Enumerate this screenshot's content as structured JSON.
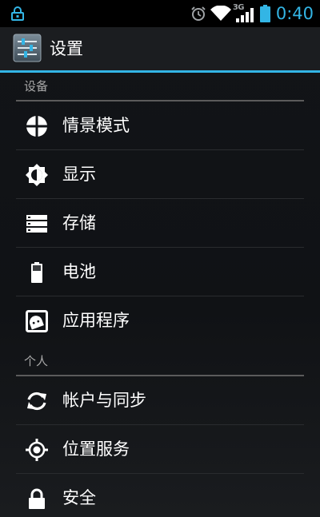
{
  "status_bar": {
    "network_type": "3G",
    "clock": "0:40",
    "accent_color": "#33b5e5",
    "icons": [
      "notification-icon",
      "alarm-icon",
      "wifi-icon",
      "signal-icon",
      "battery-icon"
    ]
  },
  "action_bar": {
    "app_icon": "settings-app-icon",
    "title": "设置"
  },
  "sections": [
    {
      "header": "设备",
      "items": [
        {
          "label": "情景模式",
          "icon": "audio-profiles-icon"
        },
        {
          "label": "显示",
          "icon": "display-icon"
        },
        {
          "label": "存储",
          "icon": "storage-icon"
        },
        {
          "label": "电池",
          "icon": "battery-icon"
        },
        {
          "label": "应用程序",
          "icon": "apps-icon"
        }
      ]
    },
    {
      "header": "个人",
      "items": [
        {
          "label": "帐户与同步",
          "icon": "sync-icon"
        },
        {
          "label": "位置服务",
          "icon": "location-icon"
        },
        {
          "label": "安全",
          "icon": "lock-icon"
        }
      ]
    }
  ]
}
